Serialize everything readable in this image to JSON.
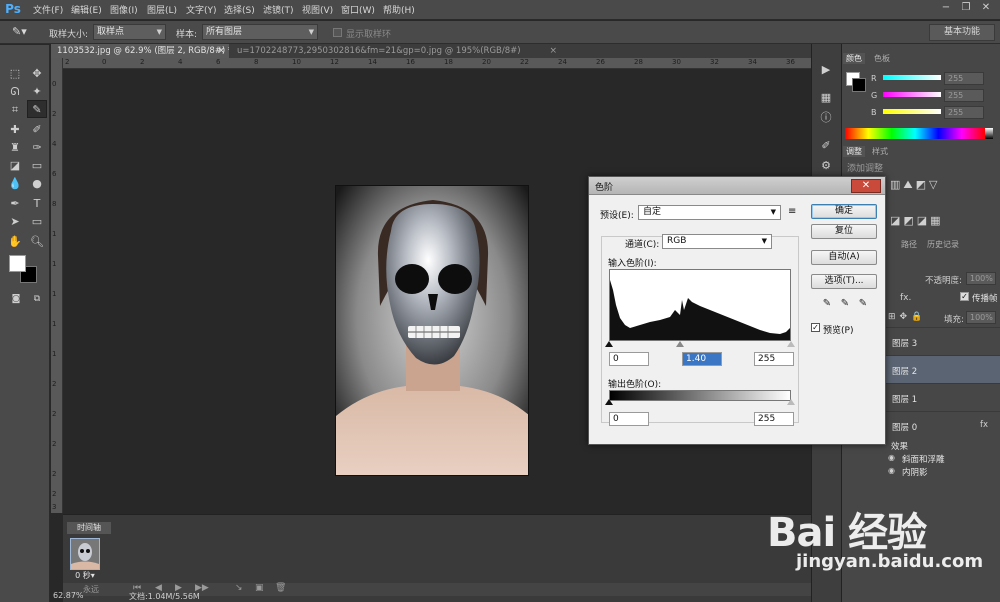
{
  "app": {
    "logo": "Ps"
  },
  "menu": [
    "文件(F)",
    "编辑(E)",
    "图像(I)",
    "图层(L)",
    "文字(Y)",
    "选择(S)",
    "滤镜(T)",
    "视图(V)",
    "窗口(W)",
    "帮助(H)"
  ],
  "options_bar": {
    "sample_size_label": "取样大小:",
    "sample_size_value": "取样点",
    "sample_label": "样本:",
    "sample_value": "所有图层",
    "show_ring_label": "显示取样环",
    "workspace": "基本功能"
  },
  "doc_tabs": [
    {
      "label": "1103532.jpg @ 62.9% (图层 2, RGB/8#) *"
    },
    {
      "label": "u=1702248773,2950302816&fm=21&gp=0.jpg @ 195%(RGB/8#)"
    }
  ],
  "ruler_top": [
    "2",
    "0",
    "2",
    "4",
    "6",
    "8",
    "10",
    "12",
    "14",
    "16",
    "18",
    "20",
    "22",
    "24",
    "26",
    "28",
    "30",
    "32",
    "34",
    "36"
  ],
  "ruler_left": [
    "0",
    "2",
    "4",
    "6",
    "8",
    "1",
    "1",
    "1",
    "1",
    "1",
    "2",
    "2",
    "2",
    "2",
    "2",
    "3"
  ],
  "timeline": {
    "tab": "时间轴",
    "frame_delay": "0 秒▾",
    "loop": "永远"
  },
  "status": {
    "zoom": "62.87%",
    "doc": "文档:1.04M/5.56M"
  },
  "color_panel": {
    "tabs": [
      "颜色",
      "色板"
    ],
    "channels": [
      {
        "label": "R",
        "value": "255"
      },
      {
        "label": "G",
        "value": "255"
      },
      {
        "label": "B",
        "value": "255"
      }
    ]
  },
  "adjust_panel": {
    "tabs": [
      "调整",
      "样式"
    ],
    "add_label": "添加调整"
  },
  "layers_panel": {
    "tabs": [
      "路径",
      "历史记录"
    ],
    "opacity_label": "不透明度:",
    "opacity_value": "100%",
    "fill_label": "填充:",
    "fill_value": "100%",
    "propagate_label": "传播帧",
    "layers": [
      {
        "name": "图层 3"
      },
      {
        "name": "图层 2"
      },
      {
        "name": "图层 1"
      },
      {
        "name": "图层 0"
      }
    ],
    "effects_label": "效果",
    "effects": [
      "斜面和浮雕",
      "内阴影"
    ]
  },
  "levels_dialog": {
    "title": "色阶",
    "preset_label": "预设(E):",
    "preset_value": "自定",
    "channel_label": "通道(C):",
    "channel_value": "RGB",
    "input_label": "输入色阶(I):",
    "input_black": "0",
    "input_gamma": "1.40",
    "input_white": "255",
    "output_label": "输出色阶(O):",
    "output_black": "0",
    "output_white": "255",
    "buttons": {
      "ok": "确定",
      "reset": "复位",
      "auto": "自动(A)",
      "options": "选项(T)..."
    },
    "preview_label": "预览(P)",
    "preview_checked": true
  },
  "watermark": {
    "logo": "Bai 经验",
    "url": "jingyan.baidu.com"
  }
}
